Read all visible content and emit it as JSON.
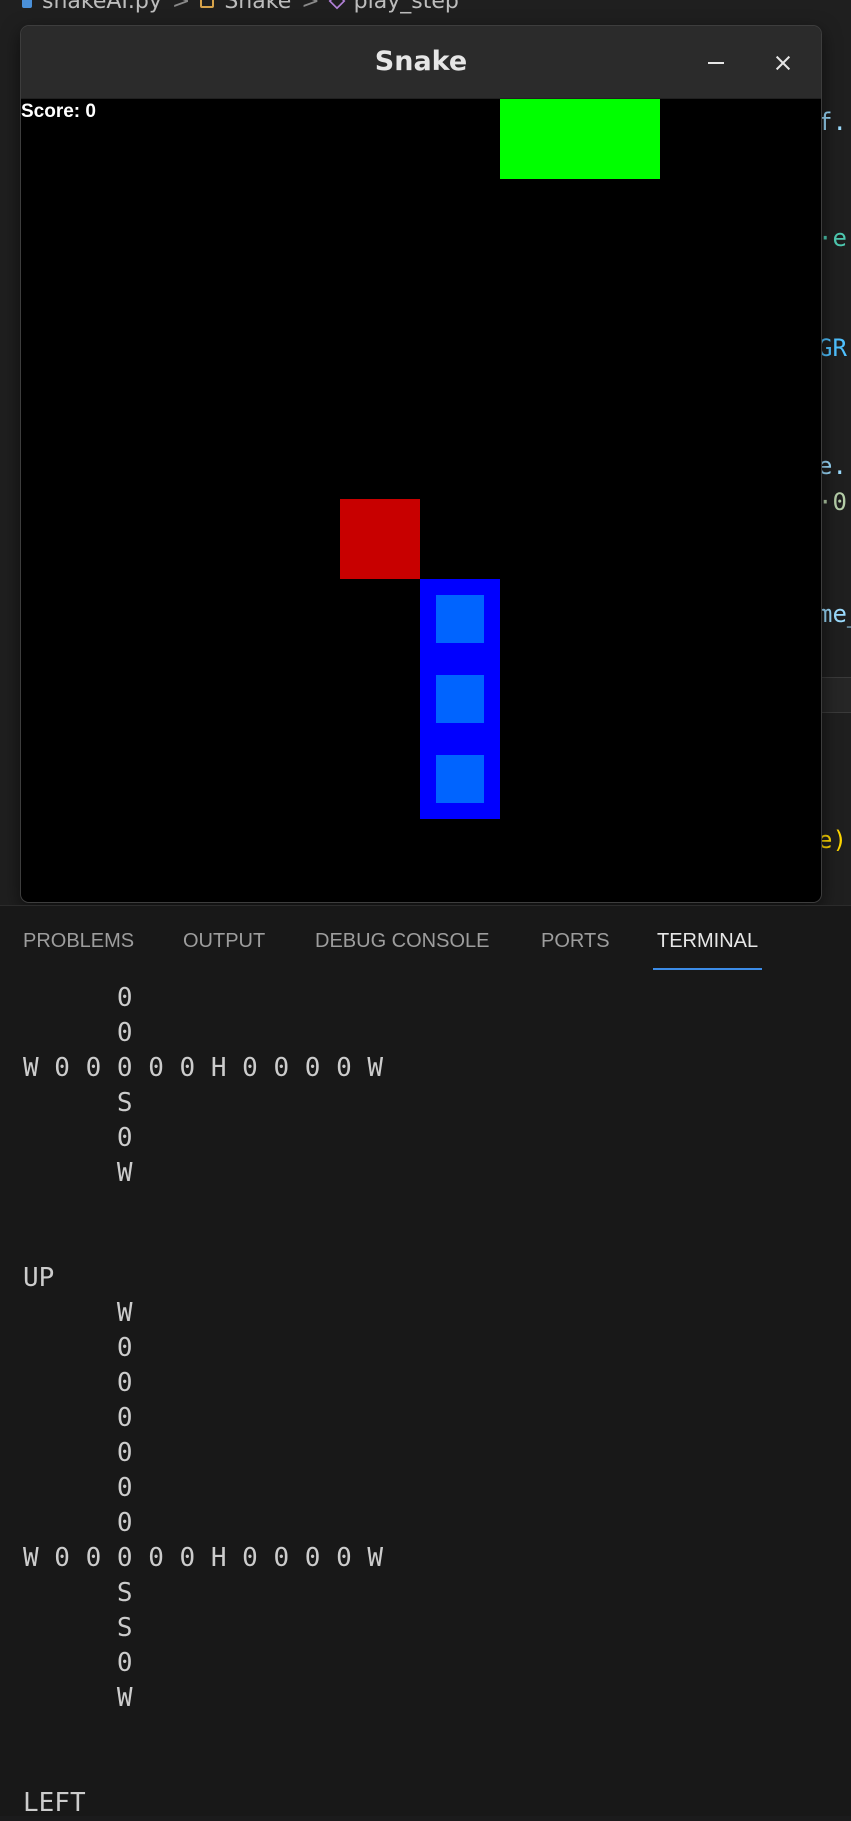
{
  "editor": {
    "breadcrumb": {
      "file": "snakeAI.py",
      "class": "Snake",
      "method": "play_step",
      "separator": ">"
    },
    "code_fragments": [
      {
        "text": "f.",
        "color": "#9cdcfe"
      },
      {
        "text": "·e",
        "color": "#4ec9b0"
      },
      {
        "text": "GR",
        "color": "#4fc1ff"
      },
      {
        "text": "e.",
        "color": "#9cdcfe"
      },
      {
        "text": "·0",
        "color": "#b5cea8"
      },
      {
        "text": "me_",
        "color": "#9cdcfe"
      },
      {
        "text": "e)",
        "color": "#ffd700"
      }
    ]
  },
  "snake_window": {
    "title": "Snake",
    "score": "Score: 0",
    "colors": {
      "background": "#000000",
      "food_green": "#00ff00",
      "food_red": "#c80000",
      "snake_body": "#0000ff",
      "snake_inner": "#0064ff"
    }
  },
  "panel": {
    "tabs": [
      {
        "label": "PROBLEMS",
        "active": false
      },
      {
        "label": "OUTPUT",
        "active": false
      },
      {
        "label": "DEBUG CONSOLE",
        "active": false
      },
      {
        "label": "PORTS",
        "active": false
      },
      {
        "label": "TERMINAL",
        "active": true
      }
    ],
    "terminal_lines": [
      "      0",
      "      0",
      "W 0 0 0 0 0 H 0 0 0 0 W",
      "      S",
      "      0",
      "      W",
      "",
      "",
      "UP",
      "      W",
      "      0",
      "      0",
      "      0",
      "      0",
      "      0",
      "      0",
      "W 0 0 0 0 0 H 0 0 0 0 W",
      "      S",
      "      S",
      "      0",
      "      W",
      "",
      "",
      "LEFT"
    ]
  }
}
